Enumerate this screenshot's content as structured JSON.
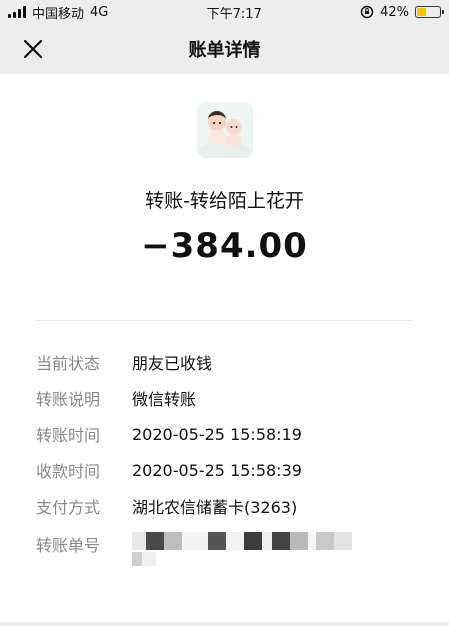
{
  "status_bar": {
    "carrier": "中国移动",
    "network": "4G",
    "time": "下午7:17",
    "battery_pct": "42%",
    "battery_level": 0.42
  },
  "nav": {
    "title": "账单详情",
    "close_icon": "close-icon"
  },
  "transfer": {
    "title": "转账-转给陌上花开",
    "amount": "−384.00"
  },
  "details": [
    {
      "label": "当前状态",
      "value": "朋友已收钱"
    },
    {
      "label": "转账说明",
      "value": "微信转账"
    },
    {
      "label": "转账时间",
      "value": "2020-05-25 15:58:19"
    },
    {
      "label": "收款时间",
      "value": "2020-05-25 15:58:39"
    },
    {
      "label": "支付方式",
      "value": "湖北农信储蓄卡(3263)"
    },
    {
      "label": "转账单号",
      "value": ""
    }
  ],
  "colors": {
    "page_bg": "#ededed",
    "card_bg": "#ffffff",
    "label": "#888888",
    "battery": "#f2c200"
  }
}
